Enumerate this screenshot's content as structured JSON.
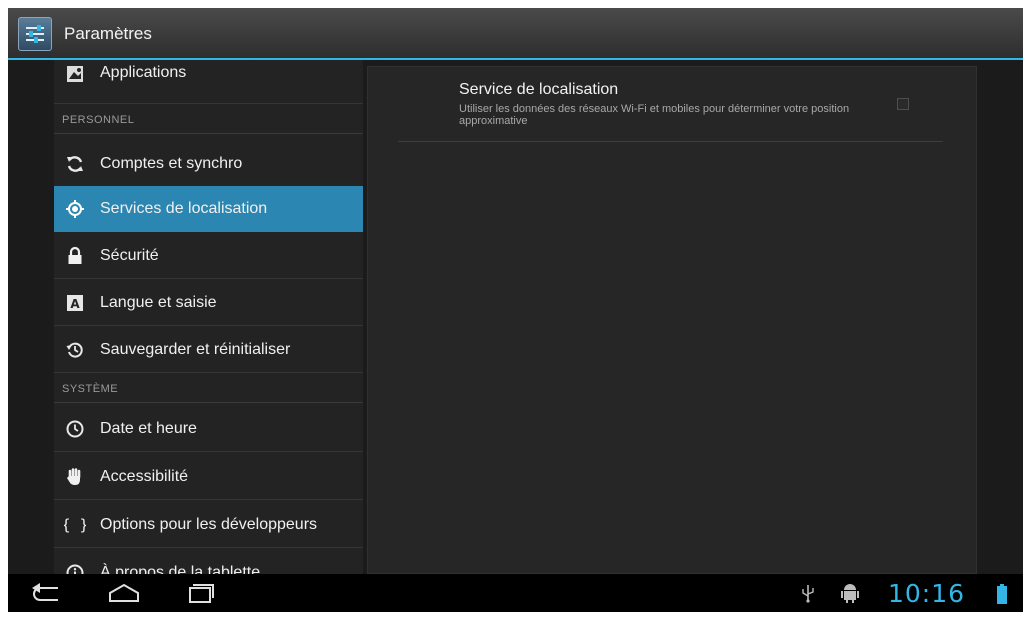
{
  "app": {
    "title": "Paramètres"
  },
  "sidebar": {
    "items": [
      {
        "label": "Applications",
        "icon": "applications-icon"
      },
      {
        "header": "PERSONNEL"
      },
      {
        "label": "Comptes et synchro",
        "icon": "sync-icon"
      },
      {
        "label": "Services de localisation",
        "icon": "location-icon",
        "selected": true
      },
      {
        "label": "Sécurité",
        "icon": "lock-icon"
      },
      {
        "label": "Langue et saisie",
        "icon": "keyboard-icon"
      },
      {
        "label": "Sauvegarder et réinitialiser",
        "icon": "backup-icon"
      },
      {
        "header": "SYSTÈME"
      },
      {
        "label": "Date et heure",
        "icon": "clock-icon"
      },
      {
        "label": "Accessibilité",
        "icon": "hand-icon"
      },
      {
        "label": "Options pour les développeurs",
        "icon": "braces-icon"
      },
      {
        "label": "À propos de la tablette",
        "icon": "info-icon"
      }
    ]
  },
  "detail": {
    "pref_title": "Service de localisation",
    "pref_summary": "Utiliser les données des réseaux Wi-Fi et mobiles pour déterminer votre position approximative",
    "pref_checked": false
  },
  "statusbar": {
    "time": "10:16",
    "icons": [
      "usb-icon",
      "android-debug-icon",
      "battery-icon"
    ]
  },
  "navigation": {
    "buttons": [
      "back-button",
      "home-button",
      "recent-apps-button"
    ]
  },
  "colors": {
    "accent": "#33b5e5",
    "selected_bg": "#2b86b2"
  }
}
